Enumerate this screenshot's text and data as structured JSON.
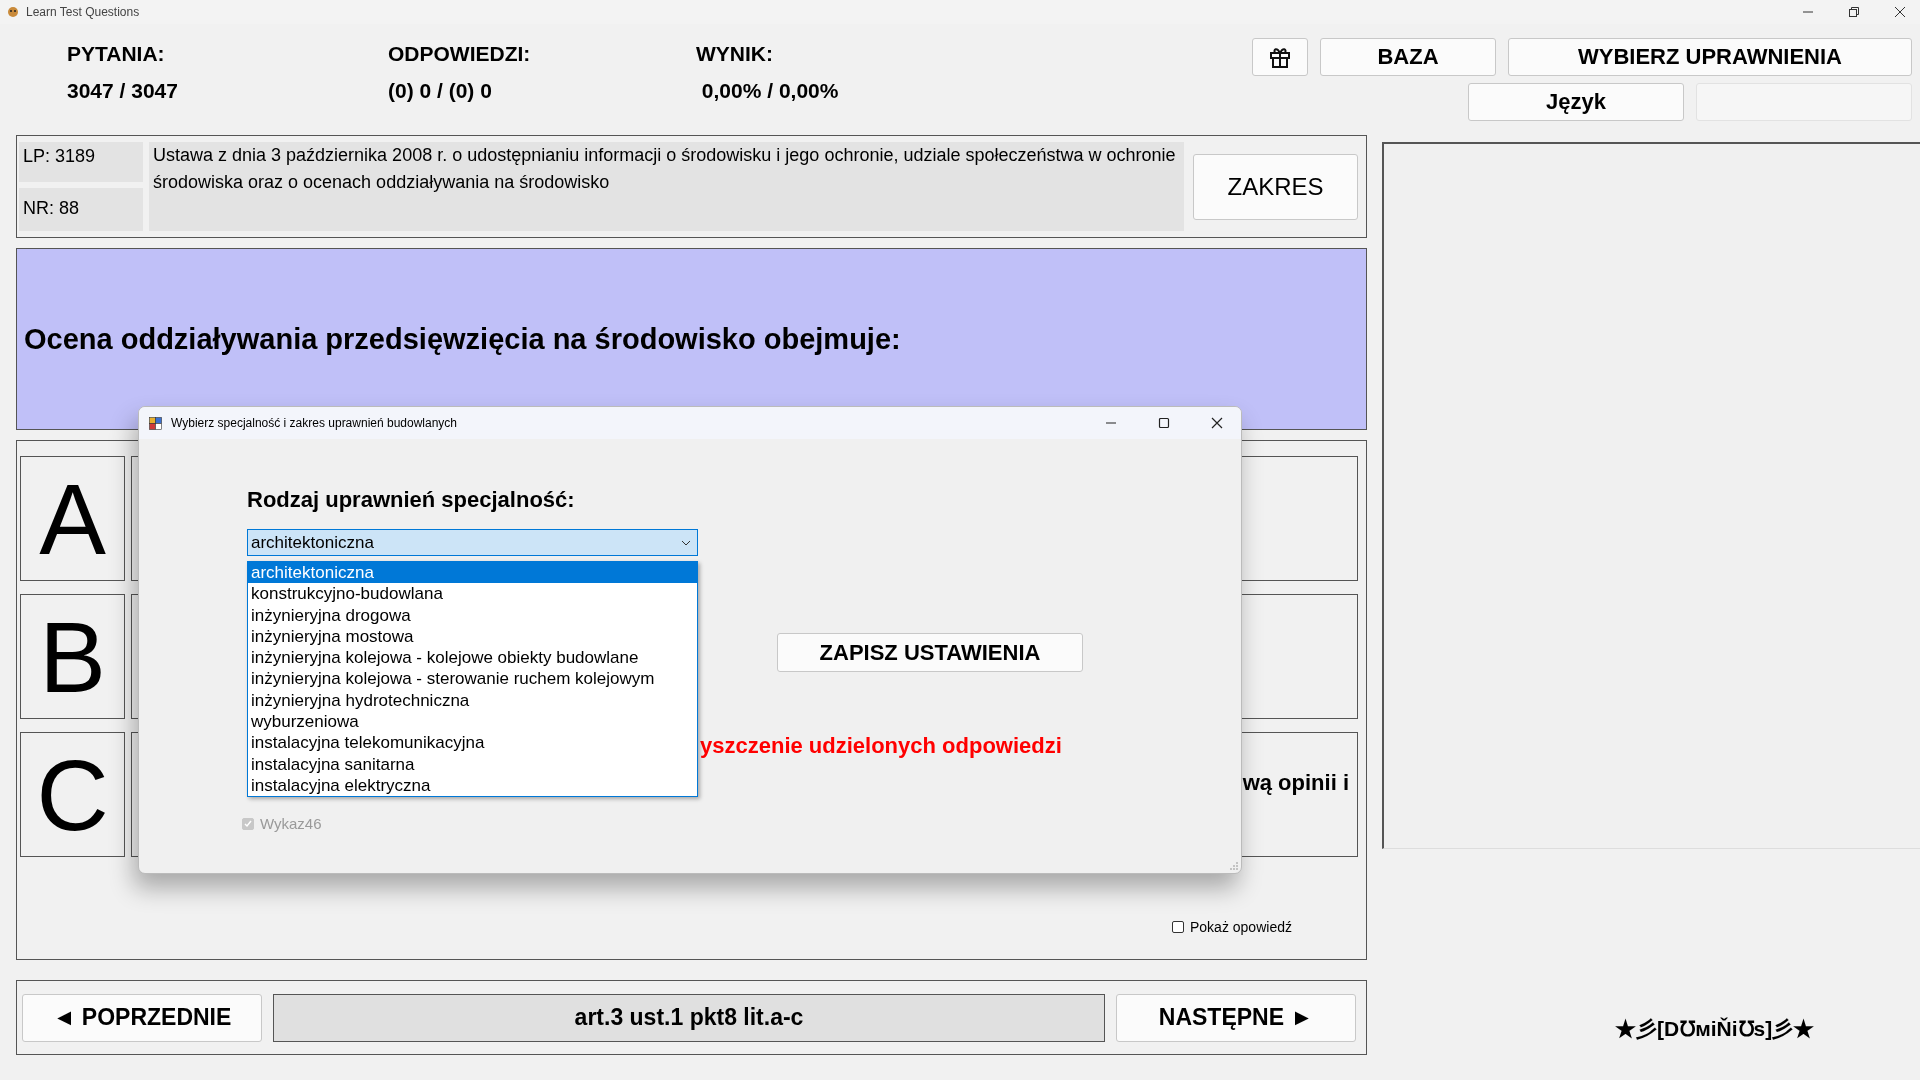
{
  "window": {
    "title": "Learn Test Questions"
  },
  "stats": [
    {
      "label": "PYTANIA:",
      "value": "3047 / 3047"
    },
    {
      "label": "ODPOWIEDZI:",
      "value": "(0) 0 / (0) 0"
    },
    {
      "label": "WYNIK:",
      "value": " 0,00% / 0,00%"
    }
  ],
  "top_buttons": [
    {
      "kind": "icon"
    },
    {
      "kind": "text",
      "label": "BAZA"
    },
    {
      "kind": "text",
      "label": "WYBIERZ UPRAWNIENIA"
    }
  ],
  "language_button": "Język",
  "question_info": {
    "lp": "LP: 3189",
    "nr": "NR: 88",
    "source": "Ustawa z dnia 3 października 2008 r. o udostępnianiu informacji o środowisku i jego ochronie, udziale społeczeństwa w ochronie środowiska oraz o ocenach oddziaływania na środowisko",
    "scope_button": "ZAKRES"
  },
  "question": "Ocena oddziaływania przedsięwzięcia na środowisko obejmuje:",
  "answers": [
    {
      "letter": "A"
    },
    {
      "letter": "B"
    },
    {
      "letter": "C",
      "text": "wą opinii i"
    }
  ],
  "show_answer": {
    "label": "Pokaż opowiedź",
    "checked": false
  },
  "nav": {
    "prev": "◄ POPRZEDNIE",
    "reference": "art.3 ust.1 pkt8 lit.a-c",
    "next": "NASTĘPNE ►"
  },
  "signature": "★彡[D℧мiŇi℧s]彡★",
  "dialog": {
    "title": "Wybierz specjalność i zakres uprawnień budowlanych",
    "label": "Rodzaj uprawnień specjalność:",
    "combo": {
      "value": "architektoniczna",
      "expanded": true
    },
    "options": [
      {
        "label": "architektoniczna",
        "selected": true
      },
      {
        "label": "konstrukcyjno-budowlana",
        "selected": false
      },
      {
        "label": "inżynieryjna drogowa",
        "selected": false
      },
      {
        "label": "inżynieryjna mostowa",
        "selected": false
      },
      {
        "label": "inżynieryjna kolejowa - kolejowe obiekty budowlane",
        "selected": false
      },
      {
        "label": "inżynieryjna kolejowa - sterowanie ruchem kolejowym",
        "selected": false
      },
      {
        "label": "inżynieryjna hydrotechniczna",
        "selected": false
      },
      {
        "label": "wyburzeniowa",
        "selected": false
      },
      {
        "label": "instalacyjna telekomunikacyjna",
        "selected": false
      },
      {
        "label": "instalacyjna sanitarna",
        "selected": false
      },
      {
        "label": "instalacyjna elektryczna",
        "selected": false
      }
    ],
    "save_button": "ZAPISZ USTAWIENIA",
    "warning": "yszczenie udzielonych odpowiedzi",
    "checkboxes": [
      {
        "label": "Wykaz46",
        "checked": true,
        "disabled": true
      }
    ]
  }
}
